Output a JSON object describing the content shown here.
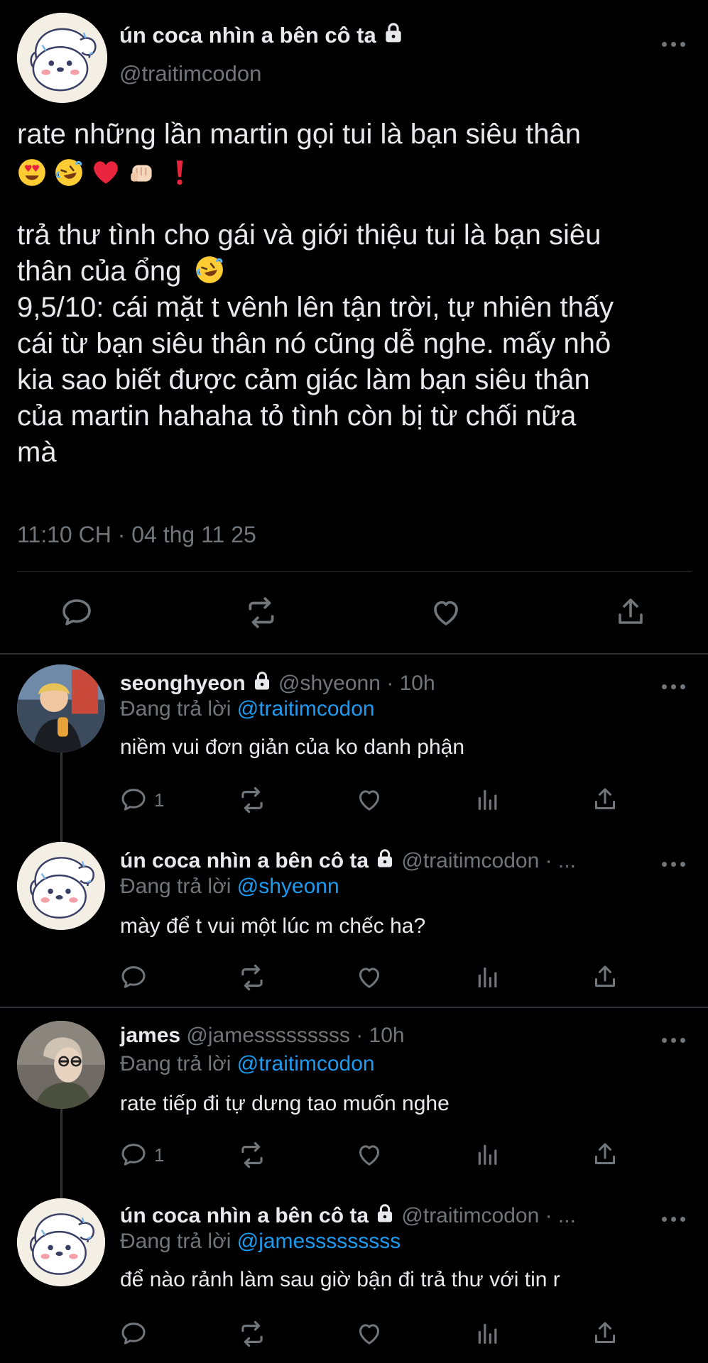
{
  "main_tweet": {
    "name": "ún coca nhìn a bên cô ta",
    "handle": "@traitimcodon",
    "text_line1": "rate những lần martin gọi tui là bạn siêu thân",
    "emoji_row": [
      "heart-eyes",
      "rolling-laughing",
      "red-heart",
      "fist-bump",
      "exclamation"
    ],
    "text_line2": "trả thư tình cho gái và giới thiệu tui là bạn siêu",
    "text_line3": "thân của ổng",
    "text_line4": "9,5/10: cái mặt t vênh lên tận trời, tự nhiên thấy",
    "text_line5": "cái từ bạn siêu thân nó cũng dễ nghe. mấy nhỏ",
    "text_line6": "kia sao biết được cảm giác làm bạn siêu thân",
    "text_line7": "của martin hahaha tỏ tình còn bị từ chối nữa",
    "text_line8": "mà",
    "timestamp": "11:10 CH · 04 thg 11 25",
    "actions": [
      "reply-icon",
      "retweet-icon",
      "like-icon",
      "share-icon"
    ]
  },
  "replies": [
    {
      "name": "seonghyeon",
      "locked": true,
      "handle_time": "@shyeonn · 10h",
      "replying_prefix": "Đang trả lời",
      "replying_to": "@traitimcodon",
      "text": "niềm vui đơn giản của ko danh phận",
      "reply_count": "1"
    },
    {
      "name": "ún coca nhìn a bên cô ta",
      "locked": true,
      "handle_time": "@traitimcodon · ...",
      "replying_prefix": "Đang trả lời",
      "replying_to": "@shyeonn",
      "text": "mày để t vui một lúc m chếc ha?",
      "reply_count": ""
    },
    {
      "name": "james",
      "locked": false,
      "handle_time": "@jamesssssssss · 10h",
      "replying_prefix": "Đang trả lời",
      "replying_to": "@traitimcodon",
      "text": "rate tiếp đi tự dưng tao muốn nghe",
      "reply_count": "1"
    },
    {
      "name": "ún coca nhìn a bên cô ta",
      "locked": true,
      "handle_time": "@traitimcodon · ...",
      "replying_prefix": "Đang trả lời",
      "replying_to": "@jamesssssssss",
      "text": "để nào rảnh làm sau giờ bận đi trả thư với tin r",
      "reply_count": ""
    }
  ],
  "colors": {
    "background": "#000000",
    "text": "#e7e9ea",
    "secondary": "#71767b",
    "accent": "#1d9bf0",
    "divider": "#2f3336"
  }
}
